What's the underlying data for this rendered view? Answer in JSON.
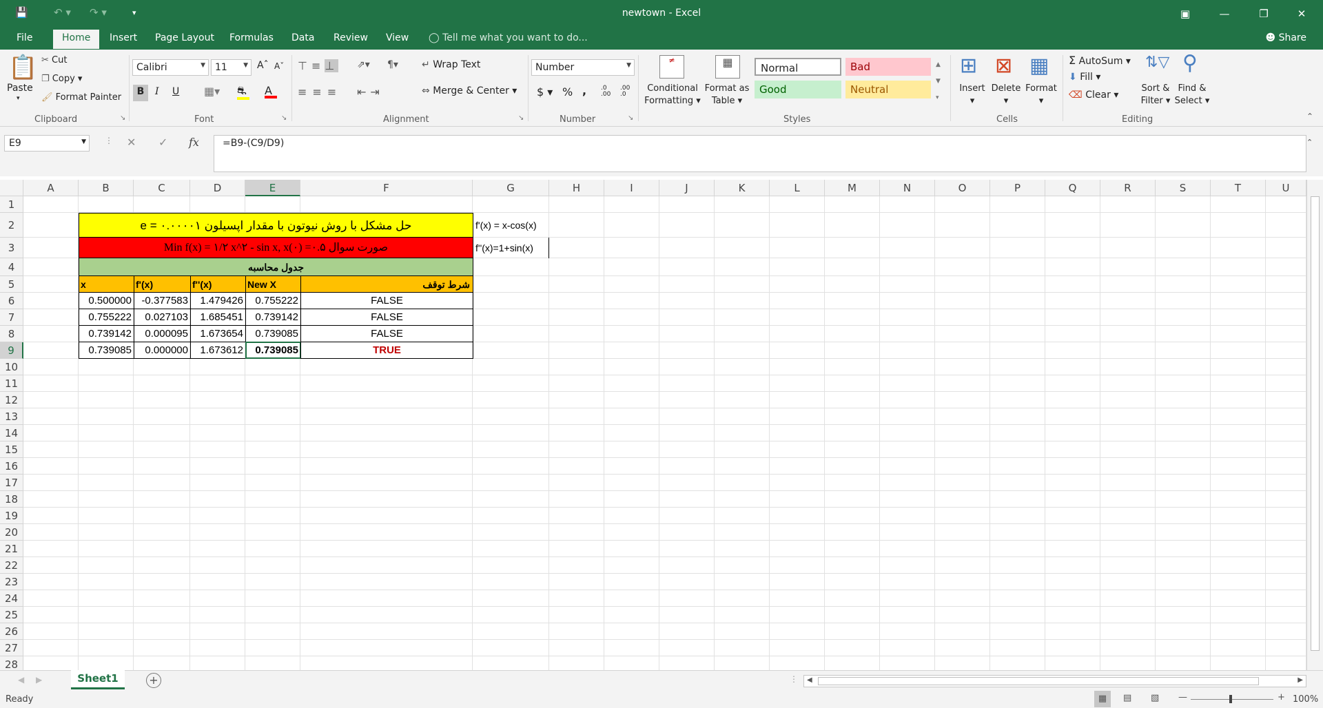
{
  "window": {
    "title": "newtown - Excel"
  },
  "menu": {
    "file": "File",
    "tabs": [
      "Home",
      "Insert",
      "Page Layout",
      "Formulas",
      "Data",
      "Review",
      "View"
    ],
    "tell_me": "Tell me what you want to do...",
    "share": "Share"
  },
  "ribbon": {
    "clipboard": {
      "paste": "Paste",
      "cut": "Cut",
      "copy": "Copy",
      "format_painter": "Format Painter",
      "label": "Clipboard"
    },
    "font": {
      "name": "Calibri",
      "size": "11",
      "bold": "B",
      "italic": "I",
      "underline": "U",
      "label": "Font"
    },
    "alignment": {
      "wrap": "Wrap Text",
      "merge": "Merge & Center",
      "label": "Alignment"
    },
    "number": {
      "format": "Number",
      "currency": "$",
      "percent": "%",
      "comma": ",",
      "inc_dec": ".0 .00",
      "dec_dec": ".00 .0",
      "label": "Number"
    },
    "styles": {
      "cond_1": "Conditional",
      "cond_2": "Formatting",
      "fmt_table_1": "Format as",
      "fmt_table_2": "Table",
      "normal": "Normal",
      "bad": "Bad",
      "good": "Good",
      "neutral": "Neutral",
      "label": "Styles"
    },
    "cells": {
      "insert": "Insert",
      "delete": "Delete",
      "format": "Format",
      "label": "Cells"
    },
    "editing": {
      "autosum": "AutoSum",
      "fill": "Fill",
      "clear": "Clear",
      "sort_1": "Sort &",
      "sort_2": "Filter",
      "find_1": "Find &",
      "find_2": "Select",
      "label": "Editing"
    }
  },
  "formula_bar": {
    "name_box": "E9",
    "formula": "=B9-(C9/D9)",
    "fx": "fx"
  },
  "columns": [
    "A",
    "B",
    "C",
    "D",
    "E",
    "F",
    "G",
    "H",
    "I",
    "J",
    "K",
    "L",
    "M",
    "N",
    "O",
    "P",
    "Q",
    "R",
    "S",
    "T",
    "U"
  ],
  "rows": [
    "1",
    "2",
    "3",
    "4",
    "5",
    "6",
    "7",
    "8",
    "9",
    "10",
    "11",
    "12",
    "13",
    "14",
    "15",
    "16",
    "17",
    "18",
    "19",
    "20",
    "21",
    "22",
    "23",
    "24",
    "25",
    "26",
    "27",
    "28"
  ],
  "sheet": {
    "title_row2": "حل مشکل با روش نیوتون با مقدار اپسیلون  ۰.۰۰۰۰۱ = e",
    "title_row3": "صورت سوال  Min f(x) = ۱/۲ x^۲ - sin x, x(۰) =۰.۵",
    "table_title": "جدول محاسبه",
    "g2": "f'(x) = x-cos(x)",
    "g3": "f''(x)=1+sin(x)",
    "headers": [
      "x",
      "f'(x)",
      "f''(x)",
      "New X",
      "شرط توقف"
    ],
    "data": [
      [
        "0.500000",
        "-0.377583",
        "1.479426",
        "0.755222",
        "FALSE"
      ],
      [
        "0.755222",
        "0.027103",
        "1.685451",
        "0.739142",
        "FALSE"
      ],
      [
        "0.739142",
        "0.000095",
        "1.673654",
        "0.739085",
        "FALSE"
      ],
      [
        "0.739085",
        "0.000000",
        "1.673612",
        "0.739085",
        "TRUE"
      ]
    ]
  },
  "sheet_tabs": {
    "active": "Sheet1"
  },
  "status": {
    "ready": "Ready",
    "zoom": "100%"
  },
  "colors": {
    "excel_green": "#217346",
    "yellow": "#ffff00",
    "red": "#ff0000",
    "light_green": "#a9d08e",
    "orange": "#ffc000"
  }
}
